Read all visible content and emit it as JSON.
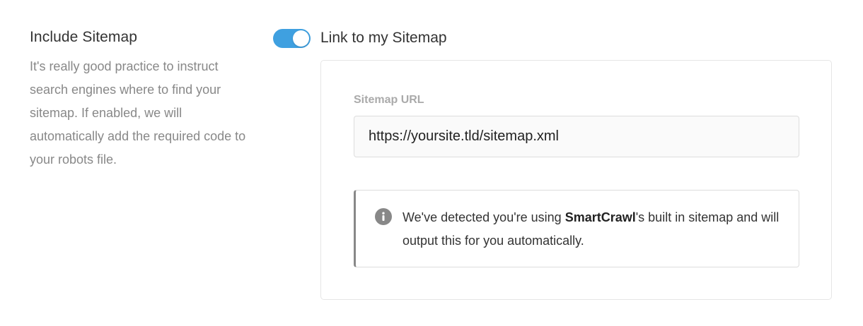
{
  "setting": {
    "title": "Include Sitemap",
    "description": "It's really good practice to instruct search engines where to find your sitemap. If enabled, we will automatically add the required code to your robots file."
  },
  "toggle": {
    "label": "Link to my Sitemap",
    "enabled": true,
    "color": "#3fa0e0"
  },
  "sitemap": {
    "field_label": "Sitemap URL",
    "url_value": "https://yoursite.tld/sitemap.xml"
  },
  "notice": {
    "icon": "info-icon",
    "text_before": "We've detected you're using ",
    "brand": "SmartCrawl",
    "text_after": "'s built in sitemap and will output this for you automatically."
  }
}
